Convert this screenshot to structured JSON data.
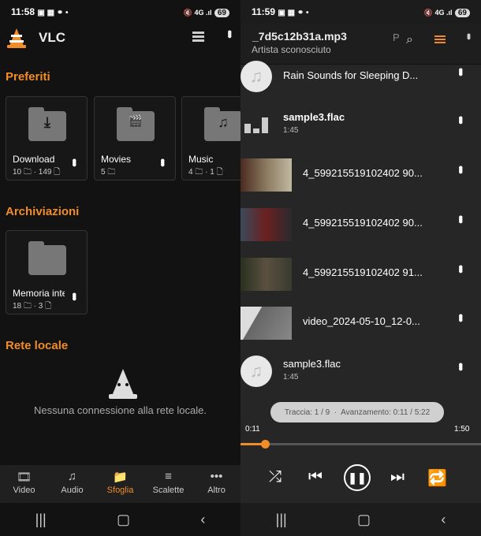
{
  "left": {
    "status": {
      "time": "11:58",
      "icons": "▣ ▦ ⚭ •",
      "right_icons": "🔇 4G .ıl",
      "battery": "69"
    },
    "app_title": "VLC",
    "sections": {
      "favorites": "Preferiti",
      "storage": "Archiviazioni",
      "local_network": "Rete locale"
    },
    "favorites": [
      {
        "name": "Download",
        "meta": "10 🗀 · 149 🗋",
        "glyph": "⤓"
      },
      {
        "name": "Movies",
        "meta": "5 🗀",
        "glyph": "🎬"
      },
      {
        "name": "Music",
        "meta": "4 🗀 · 1 🗋",
        "glyph": "♫"
      }
    ],
    "storage": [
      {
        "name": "Memoria interna",
        "meta": "18 🗀 · 3 🗋"
      }
    ],
    "empty_network": "Nessuna connessione alla rete locale.",
    "bottom_nav": [
      {
        "label": "Video",
        "icon": "🎞"
      },
      {
        "label": "Audio",
        "icon": "♫"
      },
      {
        "label": "Sfoglia",
        "icon": "📁"
      },
      {
        "label": "Scalette",
        "icon": "≡"
      },
      {
        "label": "Altro",
        "icon": "•••"
      }
    ]
  },
  "right": {
    "status": {
      "time": "11:59",
      "icons": "▣ ▦ ⚭ •",
      "right_icons": "🔇 4G .ıl",
      "battery": "69"
    },
    "now_title": "_7d5c12b31a.mp3",
    "now_artist": "Artista sconosciuto",
    "cut_letter": "P",
    "playlist": [
      {
        "title": "Rain Sounds for Sleeping D...",
        "sub": "",
        "kind": "audio"
      },
      {
        "title": "sample3.flac",
        "sub": "1:45",
        "kind": "playing"
      },
      {
        "title": "4_599215519102402 90...",
        "sub": "",
        "kind": "video"
      },
      {
        "title": "4_599215519102402 90...",
        "sub": "",
        "kind": "video"
      },
      {
        "title": "4_599215519102402 91...",
        "sub": "",
        "kind": "video"
      },
      {
        "title": "video_2024-05-10_12-0...",
        "sub": "",
        "kind": "video"
      },
      {
        "title": "sample3.flac",
        "sub": "1:45",
        "kind": "audio"
      }
    ],
    "info_pill": "Traccia: 1 / 9  ·  Avanzamento: 0:11 / 5:22",
    "elapsed": "0:11",
    "duration": "1:50",
    "progress": 0.1,
    "accent": "#f28c28"
  }
}
